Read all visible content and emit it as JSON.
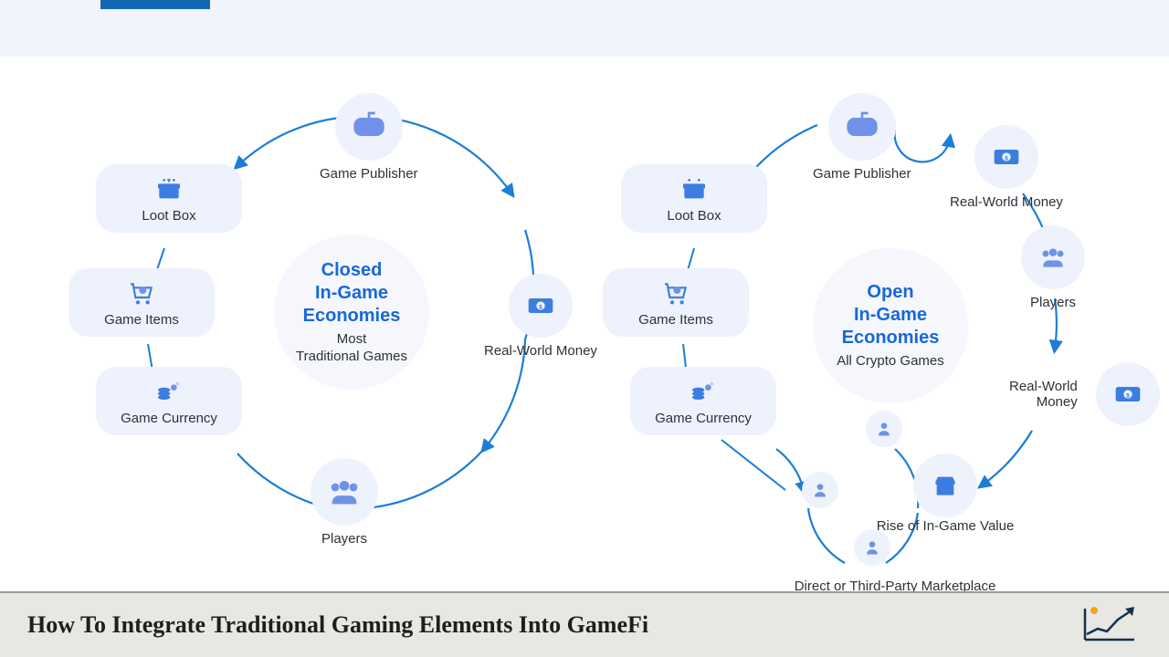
{
  "title": "How To Integrate Traditional Gaming Elements Into GameFi",
  "left": {
    "center_title": "Closed\nIn-Game\nEconomies",
    "center_subtitle": "Most\nTraditional Games",
    "nodes": {
      "publisher": "Game Publisher",
      "money": "Real-World Money",
      "players": "Players"
    },
    "boxes": {
      "lootbox": "Loot Box",
      "items": "Game Items",
      "currency": "Game Currency"
    }
  },
  "right": {
    "center_title": "Open\nIn-Game\nEconomies",
    "center_subtitle": "All Crypto Games",
    "nodes": {
      "publisher": "Game Publisher",
      "money_top": "Real-World Money",
      "players": "Players",
      "money_mid": "Real-World\nMoney",
      "rise": "Rise of In-Game Value",
      "marketplace": "Direct or Third-Party Marketplace"
    },
    "boxes": {
      "lootbox": "Loot Box",
      "items": "Game Items",
      "currency": "Game Currency"
    }
  }
}
